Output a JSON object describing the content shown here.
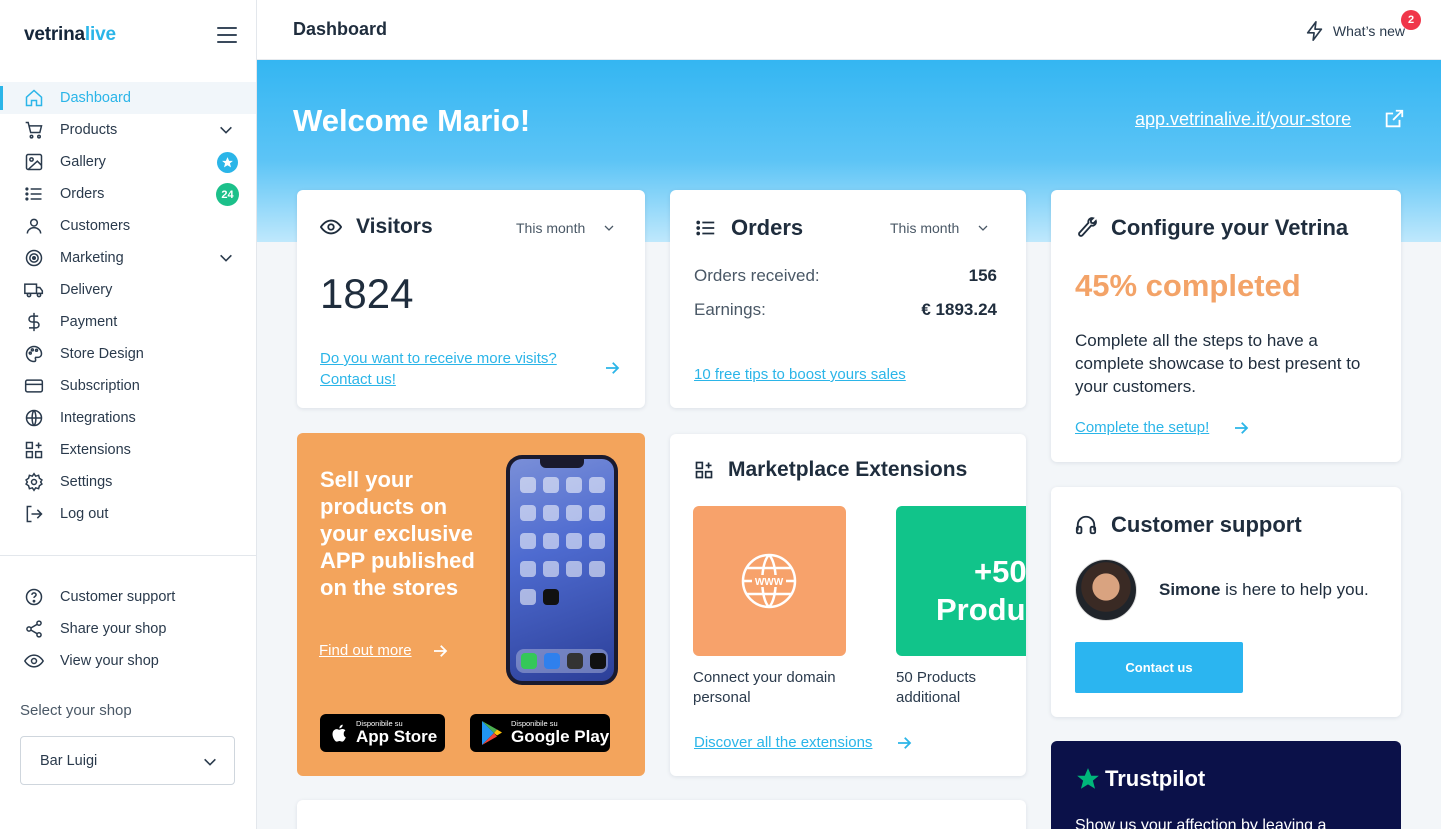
{
  "brand": {
    "name_a": "vetrina",
    "name_b": "live"
  },
  "sidebar": {
    "items": [
      {
        "label": "Dashboard",
        "icon": "home-icon"
      },
      {
        "label": "Products",
        "icon": "cart-icon"
      },
      {
        "label": "Gallery",
        "icon": "image-icon"
      },
      {
        "label": "Orders",
        "icon": "list-icon",
        "badge": "24"
      },
      {
        "label": "Customers",
        "icon": "user-icon"
      },
      {
        "label": "Marketing",
        "icon": "target-icon"
      },
      {
        "label": "Delivery",
        "icon": "truck-icon"
      },
      {
        "label": "Payment",
        "icon": "dollar-icon"
      },
      {
        "label": "Store Design",
        "icon": "palette-icon"
      },
      {
        "label": "Subscription",
        "icon": "card-icon"
      },
      {
        "label": "Integrations",
        "icon": "globe-icon"
      },
      {
        "label": "Extensions",
        "icon": "grid-plus-icon"
      },
      {
        "label": "Settings",
        "icon": "gear-icon"
      },
      {
        "label": "Log out",
        "icon": "logout-icon"
      }
    ],
    "secondary": [
      {
        "label": "Customer support",
        "icon": "help-icon"
      },
      {
        "label": "Share your shop",
        "icon": "share-icon"
      },
      {
        "label": "View your shop",
        "icon": "eye-icon"
      }
    ],
    "select_label": "Select your shop",
    "selected_shop": "Bar Luigi"
  },
  "header": {
    "title": "Dashboard",
    "whats_new": "What’s new",
    "whats_new_count": "2"
  },
  "hero": {
    "welcome": "Welcome Mario!",
    "store_url": "app.vetrinalive.it/your-store"
  },
  "visitors": {
    "title": "Visitors",
    "period": "This month",
    "count": "1824",
    "link": "Do you want to receive more visits? Contact us!"
  },
  "orders": {
    "title": "Orders",
    "period": "This month",
    "received_label": "Orders received:",
    "received_value": "156",
    "earnings_label": "Earnings:",
    "earnings_value": "€ 1893.24",
    "link": "10 free tips to boost yours sales"
  },
  "configure": {
    "title": "Configure your Vetrina",
    "progress": "45% completed",
    "progress_value": 0.45,
    "text": "Complete all the steps to have a complete showcase to best present to your customers.",
    "link": "Complete the setup!"
  },
  "app_promo": {
    "title": "Sell your products on your exclusive APP published on the stores",
    "link": "Find out more",
    "appstore_small": "Disponibile su",
    "appstore_big": "App Store",
    "play_small": "Disponibile su",
    "play_big": "Google Play"
  },
  "marketplace": {
    "title": "Marketplace Extensions",
    "tile1_caption": "Connect your domain personal",
    "tile2_big": "+50",
    "tile2_big2": "Produ",
    "tile2_caption": "50 Products additional",
    "link": "Discover all the extensions",
    "colors": {
      "tile1": "#f7a26b",
      "tile2": "#11c48a"
    }
  },
  "support": {
    "title": "Customer support",
    "agent": "Simone",
    "text": " is here to help you.",
    "button": "Contact us"
  },
  "trustpilot": {
    "brand": "Trustpilot",
    "text": "Show us your affection by leaving a"
  },
  "colors": {
    "accent": "#2bb5e8",
    "progress": "#f3a368",
    "promo": "#f3a45c"
  }
}
